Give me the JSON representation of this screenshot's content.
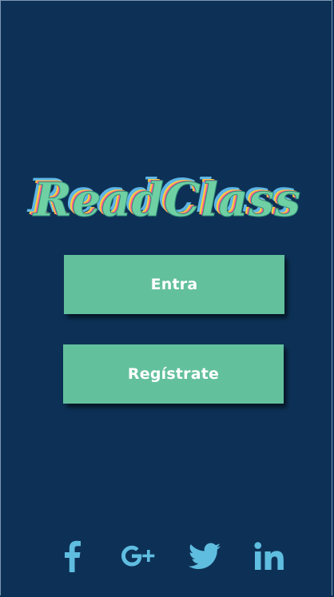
{
  "app": {
    "logo_text": "ReadClass"
  },
  "buttons": {
    "login_label": "Entra",
    "register_label": "Regístrate"
  },
  "social": {
    "facebook_icon": "facebook-icon",
    "googleplus_icon": "google-plus-icon",
    "twitter_icon": "twitter-icon",
    "linkedin_icon": "linkedin-icon",
    "color": "#5fbde0"
  },
  "colors": {
    "background": "#0d3156",
    "button": "#63c09d",
    "logo_green": "#6fd0a4",
    "logo_pink": "#ff5a96",
    "logo_yellow": "#ffcf3a",
    "logo_blue": "#5fb6e6"
  }
}
